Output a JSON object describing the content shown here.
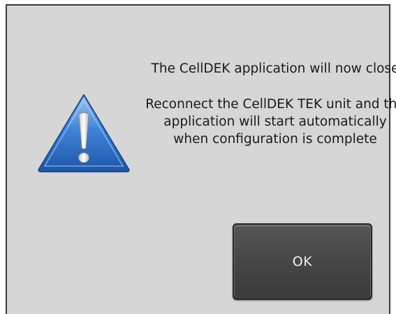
{
  "dialog": {
    "message_line1": "The CellDEK application will now close",
    "message_line2": "Reconnect the CellDEK TEK unit and the application will start automatically when configuration is complete",
    "ok_label": "OK",
    "icon": "warning-icon"
  },
  "colors": {
    "background": "#d6d6d6",
    "button": "#474747",
    "warning_blue": "#2f6fc9"
  }
}
